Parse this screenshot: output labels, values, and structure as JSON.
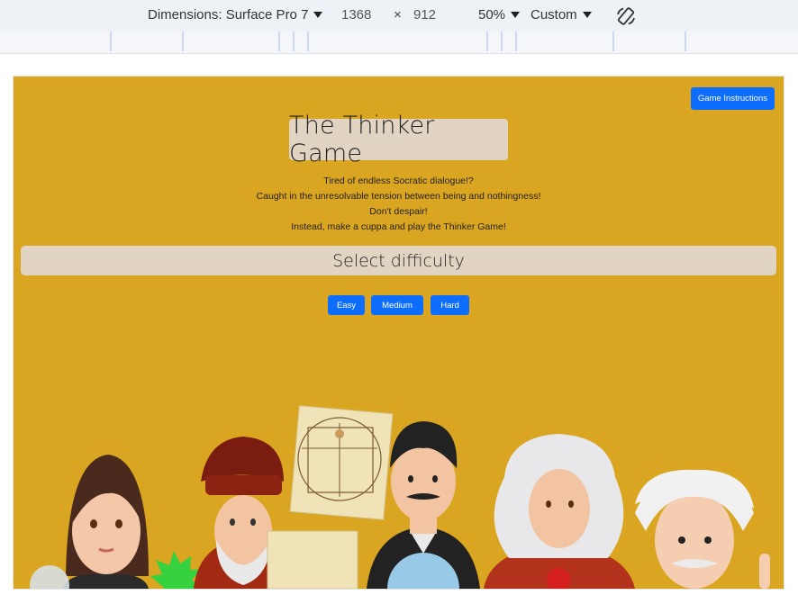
{
  "devtools": {
    "dimensions_label": "Dimensions: Surface Pro 7",
    "width": "1368",
    "times": "×",
    "height": "912",
    "zoom": "50%",
    "throttle": "Custom",
    "rotate_icon": "rotate-icon"
  },
  "page": {
    "background": "#daa520",
    "instructions_button": "Game Instructions",
    "title": "The Thinker Game",
    "tagline": [
      "Tired of endless Socratic dialogue!?",
      "Caught in the unresolvable tension between being and nothingness!",
      "Don't despair!",
      "Instead, make a cuppa and play the Thinker Game!"
    ],
    "difficulty_heading": "Select difficulty",
    "difficulty_buttons": [
      "Easy",
      "Medium",
      "Hard"
    ],
    "button_color": "#0d6efd"
  }
}
